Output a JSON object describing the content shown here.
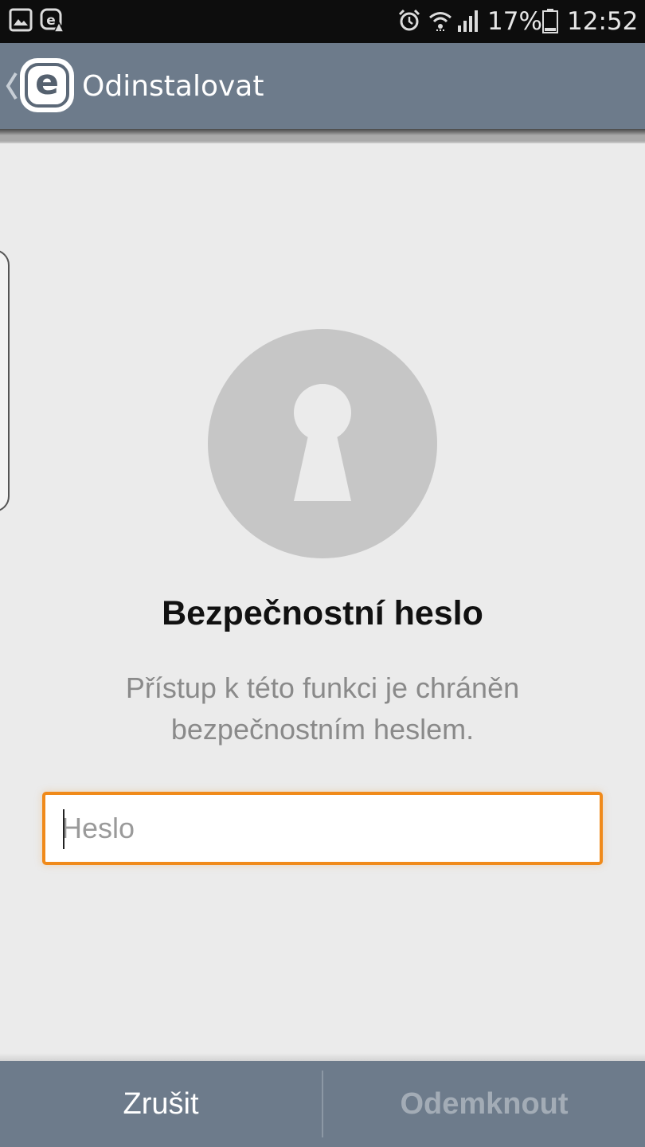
{
  "status_bar": {
    "battery_percent": "17%",
    "time": "12:52",
    "icons": [
      "gallery-notification-icon",
      "eset-notification-icon",
      "alarm-icon",
      "wifi-icon",
      "signal-icon",
      "battery-icon"
    ]
  },
  "action_bar": {
    "title": "Odinstalovat",
    "logo_letter": "e",
    "background_color": "#6d7b8b"
  },
  "lock": {
    "icon": "keyhole-icon",
    "circle_color": "#c6c6c6"
  },
  "dialog": {
    "title": "Bezpečnostní heslo",
    "description": "Přístup k této funkci je chráněn bezpečnostním heslem."
  },
  "password": {
    "placeholder": "Heslo",
    "value": "",
    "focus_color": "#f08a1a"
  },
  "buttons": {
    "cancel_label": "Zrušit",
    "unlock_label": "Odemknout",
    "unlock_enabled": false
  }
}
